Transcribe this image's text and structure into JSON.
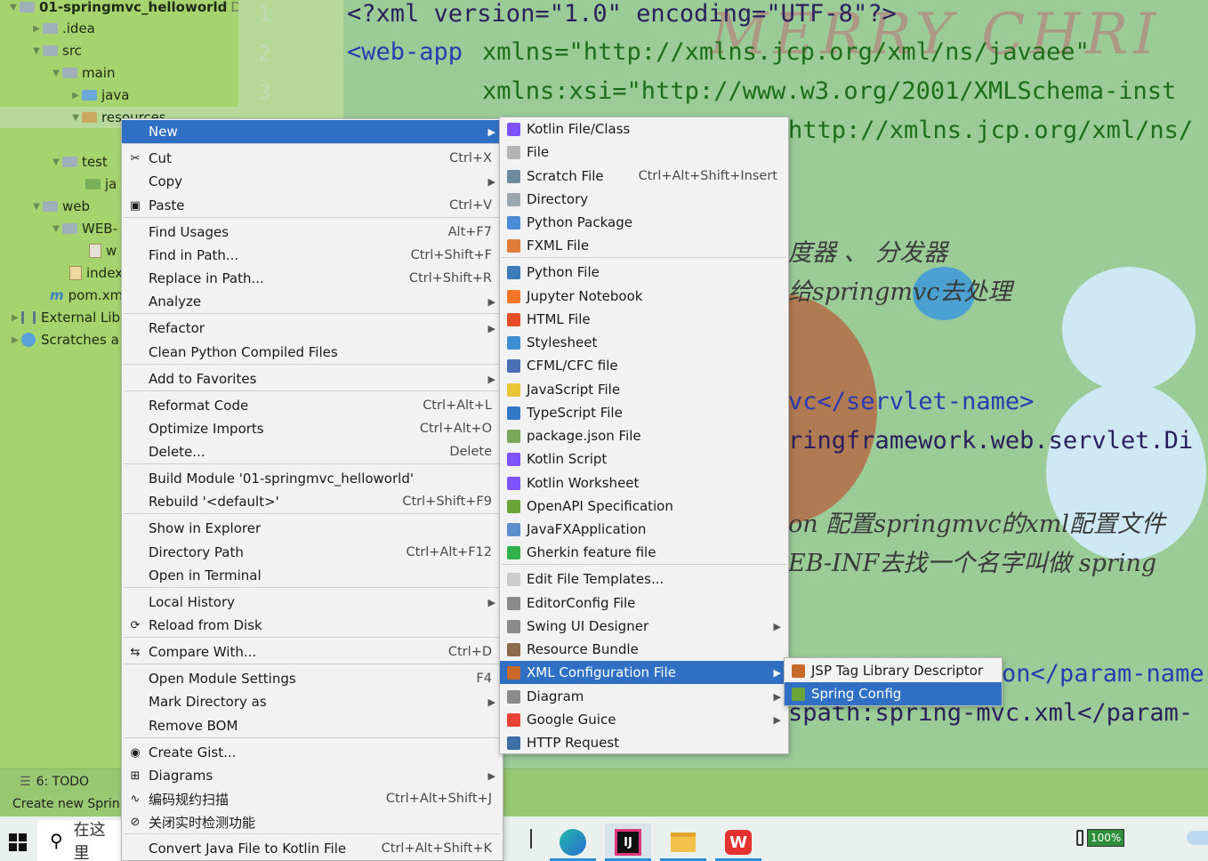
{
  "tree": {
    "project": "01-springmvc_helloworld",
    "project_suffix": "D:",
    "idea": ".idea",
    "src": "src",
    "main": "main",
    "java": "java",
    "resources": "resources",
    "test": "test",
    "test_java": "ja",
    "web": "web",
    "webinf": "WEB-",
    "w": "w",
    "index": "index",
    "pom": "pom.xm",
    "external": "External Lib",
    "scratches": "Scratches a"
  },
  "gutter": [
    "1",
    "2",
    "3"
  ],
  "editor": {
    "deco_title": "MERRY CHRI",
    "line1": "<?xml version=\"1.0\" encoding=\"UTF-8\"?>",
    "line2a": "<web-app",
    "line2b": "xmlns=\"http://xmlns.jcp.org/xml/ns/javaee\"",
    "line3": "xmlns:xsi=\"http://www.w3.org/2001/XMLSchema-inst",
    "line4": "http://xmlns.jcp.org/xml/ns/",
    "cmt1": "度器 、 分发器",
    "cmt2": "给springmvc去处理",
    "line_servlet": "vc</servlet-name>",
    "line_class": "ringframework.web.servlet.Di",
    "cmt3": "on  配置springmvc的xml配置文件",
    "cmt4": "EB-INF去找一个名字叫做  spring",
    "line_param": "on</param-name",
    "line_classpath": "spath:spring-mvc.xml</param-"
  },
  "toolstrip": {
    "todo": "6: TODO",
    "todo_num": "6"
  },
  "statusbar": {
    "text": "Create new Sprin"
  },
  "taskbar": {
    "search_text": "在这里",
    "battery": "100%"
  },
  "context_menu": {
    "items": [
      {
        "label": "New",
        "shortcut": "",
        "sub": true
      },
      {
        "label": "Cut",
        "shortcut": "Ctrl+X"
      },
      {
        "label": "Copy",
        "shortcut": "",
        "sub": true
      },
      {
        "label": "Paste",
        "shortcut": "Ctrl+V"
      },
      {
        "label": "Find Usages",
        "shortcut": "Alt+F7"
      },
      {
        "label": "Find in Path...",
        "shortcut": "Ctrl+Shift+F"
      },
      {
        "label": "Replace in Path...",
        "shortcut": "Ctrl+Shift+R"
      },
      {
        "label": "Analyze",
        "shortcut": "",
        "sub": true
      },
      {
        "label": "Refactor",
        "shortcut": "",
        "sub": true
      },
      {
        "label": "Clean Python Compiled Files",
        "shortcut": ""
      },
      {
        "label": "Add to Favorites",
        "shortcut": "",
        "sub": true
      },
      {
        "label": "Reformat Code",
        "shortcut": "Ctrl+Alt+L"
      },
      {
        "label": "Optimize Imports",
        "shortcut": "Ctrl+Alt+O"
      },
      {
        "label": "Delete...",
        "shortcut": "Delete"
      },
      {
        "label": "Build Module '01-springmvc_helloworld'",
        "shortcut": ""
      },
      {
        "label": "Rebuild '<default>'",
        "shortcut": "Ctrl+Shift+F9"
      },
      {
        "label": "Show in Explorer",
        "shortcut": ""
      },
      {
        "label": "Directory Path",
        "shortcut": "Ctrl+Alt+F12"
      },
      {
        "label": "Open in Terminal",
        "shortcut": ""
      },
      {
        "label": "Local History",
        "shortcut": "",
        "sub": true
      },
      {
        "label": "Reload from Disk",
        "shortcut": ""
      },
      {
        "label": "Compare With...",
        "shortcut": "Ctrl+D"
      },
      {
        "label": "Open Module Settings",
        "shortcut": "F4"
      },
      {
        "label": "Mark Directory as",
        "shortcut": "",
        "sub": true
      },
      {
        "label": "Remove BOM",
        "shortcut": ""
      },
      {
        "label": "Create Gist...",
        "shortcut": ""
      },
      {
        "label": "Diagrams",
        "shortcut": "",
        "sub": true
      },
      {
        "label": "编码规约扫描",
        "shortcut": "Ctrl+Alt+Shift+J"
      },
      {
        "label": "关闭实时检测功能",
        "shortcut": ""
      },
      {
        "label": "Convert Java File to Kotlin File",
        "shortcut": "Ctrl+Alt+Shift+K"
      }
    ]
  },
  "new_menu": {
    "items": [
      {
        "label": "Kotlin File/Class",
        "shortcut": ""
      },
      {
        "label": "File",
        "shortcut": ""
      },
      {
        "label": "Scratch File",
        "shortcut": "Ctrl+Alt+Shift+Insert"
      },
      {
        "label": "Directory",
        "shortcut": ""
      },
      {
        "label": "Python Package",
        "shortcut": ""
      },
      {
        "label": "FXML File",
        "shortcut": ""
      },
      {
        "label": "Python File",
        "shortcut": ""
      },
      {
        "label": "Jupyter Notebook",
        "shortcut": ""
      },
      {
        "label": "HTML File",
        "shortcut": ""
      },
      {
        "label": "Stylesheet",
        "shortcut": ""
      },
      {
        "label": "CFML/CFC file",
        "shortcut": ""
      },
      {
        "label": "JavaScript File",
        "shortcut": ""
      },
      {
        "label": "TypeScript File",
        "shortcut": ""
      },
      {
        "label": "package.json File",
        "shortcut": ""
      },
      {
        "label": "Kotlin Script",
        "shortcut": ""
      },
      {
        "label": "Kotlin Worksheet",
        "shortcut": ""
      },
      {
        "label": "OpenAPI Specification",
        "shortcut": ""
      },
      {
        "label": "JavaFXApplication",
        "shortcut": ""
      },
      {
        "label": "Gherkin feature file",
        "shortcut": ""
      },
      {
        "label": "Edit File Templates...",
        "shortcut": ""
      },
      {
        "label": "EditorConfig File",
        "shortcut": ""
      },
      {
        "label": "Swing UI Designer",
        "shortcut": "",
        "sub": true
      },
      {
        "label": "Resource Bundle",
        "shortcut": ""
      },
      {
        "label": "XML Configuration File",
        "shortcut": "",
        "sub": true
      },
      {
        "label": "Diagram",
        "shortcut": "",
        "sub": true
      },
      {
        "label": "Google Guice",
        "shortcut": "",
        "sub": true
      },
      {
        "label": "HTTP Request",
        "shortcut": ""
      }
    ]
  },
  "xml_menu": {
    "items": [
      {
        "label": "JSP Tag Library Descriptor"
      },
      {
        "label": "Spring Config"
      }
    ]
  },
  "colors": {
    "highlight": "#2f70c4",
    "menu_bg": "#f2f2f2",
    "tree_bg": "#a5d36d",
    "editor_bg": "#9bcc98"
  },
  "icons": {
    "submenu": "chevron-right-icon",
    "cut": "scissors-icon",
    "paste": "clipboard-icon"
  },
  "glyphs": {
    "chevron": "▶",
    "arrow_down": "▼",
    "arrow_right": "▶"
  }
}
